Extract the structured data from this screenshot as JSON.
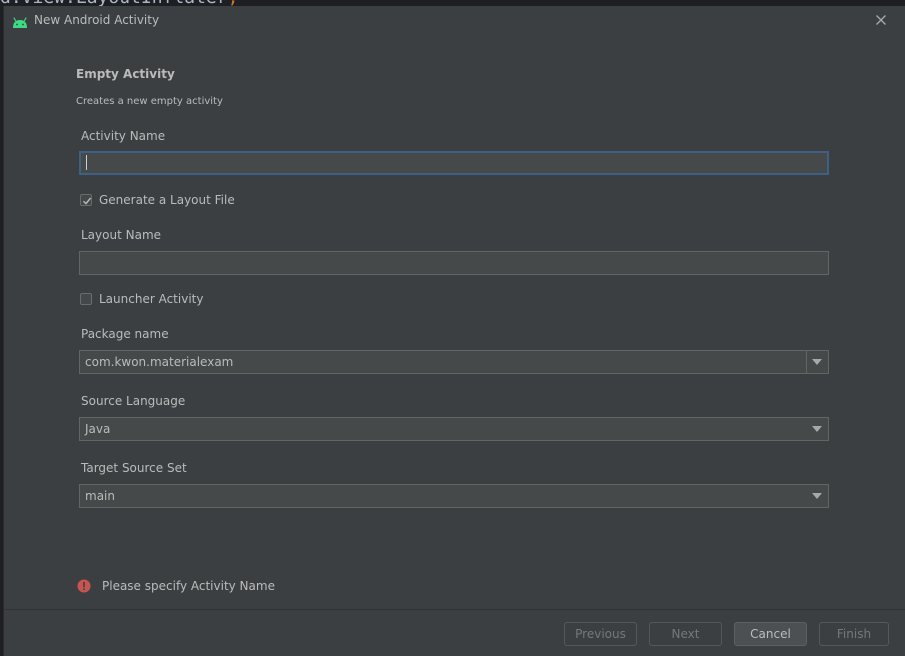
{
  "background_code": {
    "text": "d.View.LayoutInflater",
    "punctuation": ";"
  },
  "dialog": {
    "title": "New Android Activity",
    "heading": "Empty Activity",
    "description": "Creates a new empty activity"
  },
  "form": {
    "activity_name": {
      "label": "Activity Name",
      "value": ""
    },
    "generate_layout": {
      "label": "Generate a Layout File",
      "checked": true
    },
    "layout_name": {
      "label": "Layout Name",
      "value": ""
    },
    "launcher_activity": {
      "label": "Launcher Activity",
      "checked": false
    },
    "package_name": {
      "label": "Package name",
      "value": "com.kwon.materialexam"
    },
    "source_language": {
      "label": "Source Language",
      "value": "Java"
    },
    "target_source_set": {
      "label": "Target Source Set",
      "value": "main"
    }
  },
  "error": {
    "message": "Please specify Activity Name"
  },
  "footer": {
    "previous_label": "Previous",
    "next_label": "Next",
    "cancel_label": "Cancel",
    "finish_label": "Finish"
  },
  "icons": {
    "title_icon": "android-icon",
    "close": "close-icon",
    "check": "check-icon",
    "dropdown": "chevron-down-icon",
    "error": "error-icon"
  },
  "colors": {
    "dialog_bg": "#3c3f41",
    "field_bg": "#45494a",
    "focus_border": "#3d6185",
    "android_green": "#3ddc84",
    "error_red": "#c75450"
  }
}
